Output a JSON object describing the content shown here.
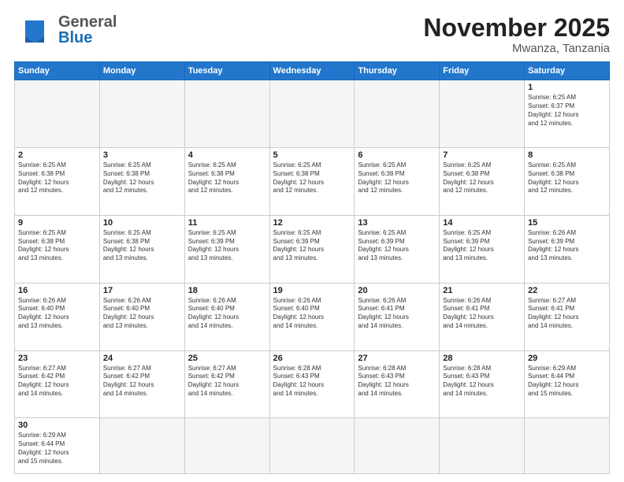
{
  "header": {
    "logo_general": "General",
    "logo_blue": "Blue",
    "month_title": "November 2025",
    "location": "Mwanza, Tanzania"
  },
  "days_of_week": [
    "Sunday",
    "Monday",
    "Tuesday",
    "Wednesday",
    "Thursday",
    "Friday",
    "Saturday"
  ],
  "weeks": [
    [
      {
        "day": "",
        "info": ""
      },
      {
        "day": "",
        "info": ""
      },
      {
        "day": "",
        "info": ""
      },
      {
        "day": "",
        "info": ""
      },
      {
        "day": "",
        "info": ""
      },
      {
        "day": "",
        "info": ""
      },
      {
        "day": "1",
        "info": "Sunrise: 6:25 AM\nSunset: 6:37 PM\nDaylight: 12 hours\nand 12 minutes."
      }
    ],
    [
      {
        "day": "2",
        "info": "Sunrise: 6:25 AM\nSunset: 6:38 PM\nDaylight: 12 hours\nand 12 minutes."
      },
      {
        "day": "3",
        "info": "Sunrise: 6:25 AM\nSunset: 6:38 PM\nDaylight: 12 hours\nand 12 minutes."
      },
      {
        "day": "4",
        "info": "Sunrise: 6:25 AM\nSunset: 6:38 PM\nDaylight: 12 hours\nand 12 minutes."
      },
      {
        "day": "5",
        "info": "Sunrise: 6:25 AM\nSunset: 6:38 PM\nDaylight: 12 hours\nand 12 minutes."
      },
      {
        "day": "6",
        "info": "Sunrise: 6:25 AM\nSunset: 6:38 PM\nDaylight: 12 hours\nand 12 minutes."
      },
      {
        "day": "7",
        "info": "Sunrise: 6:25 AM\nSunset: 6:38 PM\nDaylight: 12 hours\nand 12 minutes."
      },
      {
        "day": "8",
        "info": "Sunrise: 6:25 AM\nSunset: 6:38 PM\nDaylight: 12 hours\nand 12 minutes."
      }
    ],
    [
      {
        "day": "9",
        "info": "Sunrise: 6:25 AM\nSunset: 6:38 PM\nDaylight: 12 hours\nand 13 minutes."
      },
      {
        "day": "10",
        "info": "Sunrise: 6:25 AM\nSunset: 6:38 PM\nDaylight: 12 hours\nand 13 minutes."
      },
      {
        "day": "11",
        "info": "Sunrise: 6:25 AM\nSunset: 6:39 PM\nDaylight: 12 hours\nand 13 minutes."
      },
      {
        "day": "12",
        "info": "Sunrise: 6:25 AM\nSunset: 6:39 PM\nDaylight: 12 hours\nand 13 minutes."
      },
      {
        "day": "13",
        "info": "Sunrise: 6:25 AM\nSunset: 6:39 PM\nDaylight: 12 hours\nand 13 minutes."
      },
      {
        "day": "14",
        "info": "Sunrise: 6:25 AM\nSunset: 6:39 PM\nDaylight: 12 hours\nand 13 minutes."
      },
      {
        "day": "15",
        "info": "Sunrise: 6:26 AM\nSunset: 6:39 PM\nDaylight: 12 hours\nand 13 minutes."
      }
    ],
    [
      {
        "day": "16",
        "info": "Sunrise: 6:26 AM\nSunset: 6:40 PM\nDaylight: 12 hours\nand 13 minutes."
      },
      {
        "day": "17",
        "info": "Sunrise: 6:26 AM\nSunset: 6:40 PM\nDaylight: 12 hours\nand 13 minutes."
      },
      {
        "day": "18",
        "info": "Sunrise: 6:26 AM\nSunset: 6:40 PM\nDaylight: 12 hours\nand 14 minutes."
      },
      {
        "day": "19",
        "info": "Sunrise: 6:26 AM\nSunset: 6:40 PM\nDaylight: 12 hours\nand 14 minutes."
      },
      {
        "day": "20",
        "info": "Sunrise: 6:26 AM\nSunset: 6:41 PM\nDaylight: 12 hours\nand 14 minutes."
      },
      {
        "day": "21",
        "info": "Sunrise: 6:26 AM\nSunset: 6:41 PM\nDaylight: 12 hours\nand 14 minutes."
      },
      {
        "day": "22",
        "info": "Sunrise: 6:27 AM\nSunset: 6:41 PM\nDaylight: 12 hours\nand 14 minutes."
      }
    ],
    [
      {
        "day": "23",
        "info": "Sunrise: 6:27 AM\nSunset: 6:42 PM\nDaylight: 12 hours\nand 14 minutes."
      },
      {
        "day": "24",
        "info": "Sunrise: 6:27 AM\nSunset: 6:42 PM\nDaylight: 12 hours\nand 14 minutes."
      },
      {
        "day": "25",
        "info": "Sunrise: 6:27 AM\nSunset: 6:42 PM\nDaylight: 12 hours\nand 14 minutes."
      },
      {
        "day": "26",
        "info": "Sunrise: 6:28 AM\nSunset: 6:43 PM\nDaylight: 12 hours\nand 14 minutes."
      },
      {
        "day": "27",
        "info": "Sunrise: 6:28 AM\nSunset: 6:43 PM\nDaylight: 12 hours\nand 14 minutes."
      },
      {
        "day": "28",
        "info": "Sunrise: 6:28 AM\nSunset: 6:43 PM\nDaylight: 12 hours\nand 14 minutes."
      },
      {
        "day": "29",
        "info": "Sunrise: 6:29 AM\nSunset: 6:44 PM\nDaylight: 12 hours\nand 15 minutes."
      }
    ],
    [
      {
        "day": "30",
        "info": "Sunrise: 6:29 AM\nSunset: 6:44 PM\nDaylight: 12 hours\nand 15 minutes."
      },
      {
        "day": "",
        "info": ""
      },
      {
        "day": "",
        "info": ""
      },
      {
        "day": "",
        "info": ""
      },
      {
        "day": "",
        "info": ""
      },
      {
        "day": "",
        "info": ""
      },
      {
        "day": "",
        "info": ""
      }
    ]
  ]
}
